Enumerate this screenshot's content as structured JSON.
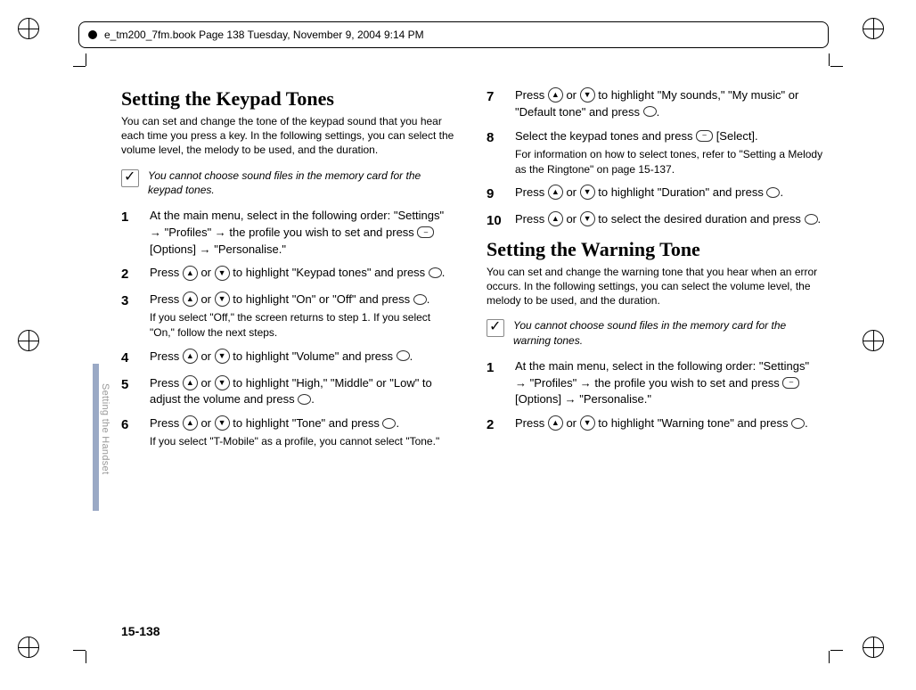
{
  "header": {
    "text": "e_tm200_7fm.book  Page 138  Tuesday, November 9, 2004  9:14 PM"
  },
  "side_label": "Setting the Handset",
  "page_number": "15-138",
  "left": {
    "heading": "Setting the Keypad Tones",
    "intro": "You can set and change the tone of the keypad sound that you hear each time you press a key. In the following settings, you can select the volume level, the melody to be used, and the duration.",
    "note": "You cannot choose sound files in the memory card for the keypad tones.",
    "steps": [
      {
        "n": "1",
        "pre": "At the main menu, select in the following order: \"Settings\" → \"Profiles\" → the profile you wish to set and press ",
        "mid": " [Options] → \"Personalise.\""
      },
      {
        "n": "2",
        "pre": "Press ",
        "mid": " or ",
        "post1": " to highlight \"Keypad tones\" and press ",
        "end": "."
      },
      {
        "n": "3",
        "pre": "Press ",
        "mid": " or ",
        "post1": " to highlight \"On\" or \"Off\" and press ",
        "end": ".",
        "sub": "If you select \"Off,\" the screen returns to step 1. If you select \"On,\" follow the next steps."
      },
      {
        "n": "4",
        "pre": "Press ",
        "mid": " or ",
        "post1": " to highlight \"Volume\" and press ",
        "end": "."
      },
      {
        "n": "5",
        "pre": "Press ",
        "mid": " or ",
        "post1": " to highlight \"High,\" \"Middle\" or \"Low\" to adjust the volume and press ",
        "end": "."
      },
      {
        "n": "6",
        "pre": "Press ",
        "mid": " or ",
        "post1": " to highlight \"Tone\" and press ",
        "end": ".",
        "sub": "If you select \"T-Mobile\" as a profile, you cannot select \"Tone.\""
      }
    ]
  },
  "right": {
    "steps_top": [
      {
        "n": "7",
        "pre": "Press ",
        "mid": " or ",
        "post1": " to highlight \"My sounds,\" \"My music\" or \"Default tone\" and press ",
        "end": "."
      },
      {
        "n": "8",
        "pre": "Select the keypad tones and press ",
        "mid": " [Select].",
        "sub": "For information on how to select tones, refer to \"Setting a Melody as the Ringtone\" on page 15-137."
      },
      {
        "n": "9",
        "pre": "Press ",
        "mid": " or ",
        "post1": " to highlight \"Duration\" and press ",
        "end": "."
      },
      {
        "n": "10",
        "pre": "Press ",
        "mid": " or ",
        "post1": " to select the desired duration and press ",
        "end": "."
      }
    ],
    "heading": "Setting the Warning Tone",
    "intro": "You can set and change the warning tone that you hear when an error occurs. In the following settings, you can select the volume level, the melody to be used, and the duration.",
    "note": "You cannot choose sound files in the memory card for the warning tones.",
    "steps_bottom": [
      {
        "n": "1",
        "pre": "At the main menu, select in the following order: \"Settings\" → \"Profiles\" → the profile you wish to set and press ",
        "mid": " [Options] → \"Personalise.\""
      },
      {
        "n": "2",
        "pre": "Press ",
        "mid": " or ",
        "post1": " to highlight \"Warning tone\" and press ",
        "end": "."
      }
    ]
  }
}
